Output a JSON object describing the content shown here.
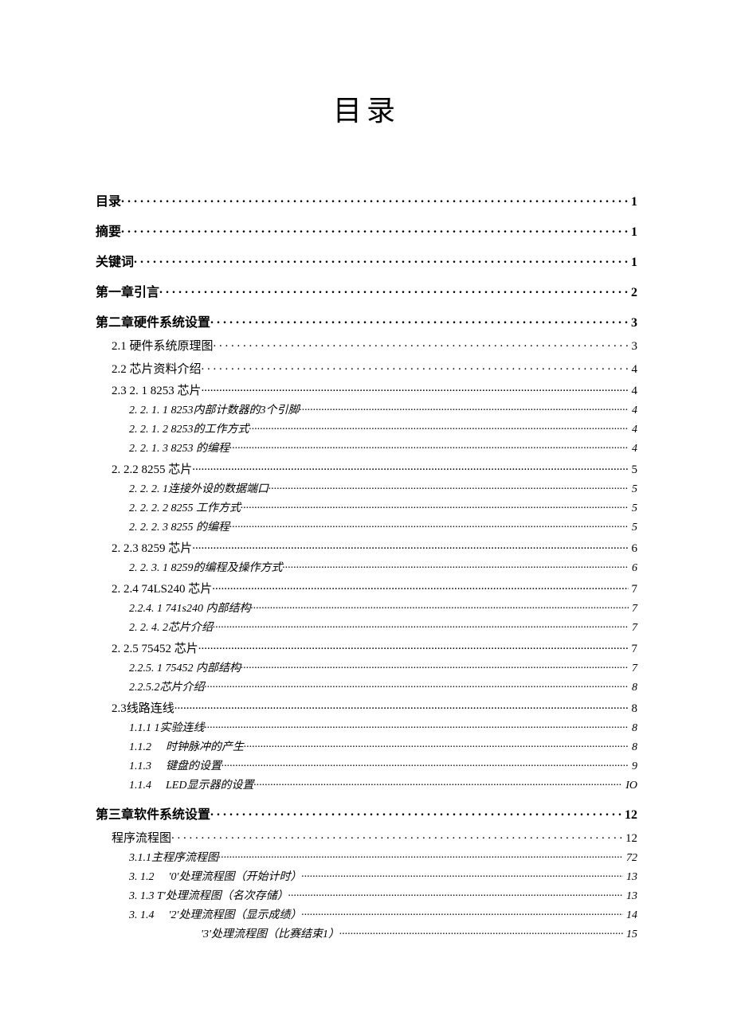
{
  "title": "目录",
  "toc": [
    {
      "level": 1,
      "label": "目录",
      "page": "1"
    },
    {
      "level": 1,
      "label": "摘要",
      "page": "1"
    },
    {
      "level": 1,
      "label": "关键词",
      "page": "1"
    },
    {
      "level": 1,
      "label": "第一章引言",
      "page": "2"
    },
    {
      "level": 1,
      "label": "第二章硬件系统设置",
      "page": "3"
    },
    {
      "level": 2,
      "label": "2.1  硬件系统原理图",
      "page": "3"
    },
    {
      "level": 2,
      "label": "2.2  芯片资料介绍",
      "page": "4"
    },
    {
      "level": 3,
      "label": "2.3 2. 1 8253 芯片",
      "page": "4"
    },
    {
      "level": 4,
      "label": "2. 2. 1. 1 8253内部计数器的3个引脚",
      "page": "4"
    },
    {
      "level": 4,
      "label": "2. 2. 1. 2 8253的工作方式",
      "page": "4"
    },
    {
      "level": 4,
      "label": "2. 2. 1. 3 8253 的编程",
      "page": "4"
    },
    {
      "level": 3,
      "label": "2. 2.2 8255 芯片",
      "page": "5"
    },
    {
      "level": 4,
      "label": "2. 2. 2. 1连接外设的数据端口",
      "page": "5"
    },
    {
      "level": 4,
      "label": "2. 2. 2. 2 8255 工作方式",
      "page": "5"
    },
    {
      "level": 4,
      "label": "2. 2. 2. 3 8255 的编程",
      "page": "5"
    },
    {
      "level": 3,
      "label": "2. 2.3 8259 芯片",
      "page": "6"
    },
    {
      "level": 4,
      "label": "2. 2. 3. 1 8259的编程及操作方式",
      "page": "6"
    },
    {
      "level": 3,
      "label": "2. 2.4 74LS240 芯片",
      "page": "7"
    },
    {
      "level": 4,
      "label": "2.2.4. 1 741s240 内部结构",
      "page": "7"
    },
    {
      "level": 4,
      "label": "2. 2. 4. 2芯片介绍",
      "page": "7"
    },
    {
      "level": 3,
      "label": "2. 2.5 75452 芯片",
      "page": "7"
    },
    {
      "level": 4,
      "label": "2.2.5. 1 75452 内部结构",
      "page": "7"
    },
    {
      "level": 4,
      "label": "2.2.5.2芯片介绍",
      "page": "8"
    },
    {
      "level": 3,
      "label": "2.3线路连线",
      "page": "8"
    },
    {
      "level": 4,
      "label": "1.1.1  1实验连线",
      "page": "8"
    },
    {
      "level": 4,
      "label_num": "1.1.2",
      "label": "时钟脉冲的产生",
      "page": "8"
    },
    {
      "level": 4,
      "label_num": "1.1.3",
      "label": "键盘的设置",
      "page": "9"
    },
    {
      "level": 4,
      "label_num": "1.1.4",
      "label": "LED显示器的设置",
      "page": "IO"
    },
    {
      "level": 1,
      "label": "第三章软件系统设置",
      "page": "12"
    },
    {
      "level": 2,
      "label": "程序流程图",
      "page": "12"
    },
    {
      "level": 4,
      "label": "3.1.1主程序流程图",
      "page": "72"
    },
    {
      "level": 4,
      "label_num": "3. 1.2",
      "label": "'0'处理流程图（开始计时）",
      "page": "13"
    },
    {
      "level": 4,
      "label": "3. 1.3 T'处理流程图（名次存储）",
      "page": "13"
    },
    {
      "level": 4,
      "label_num": "3. 1.4",
      "label": "'2'处理流程图（显示成绩）",
      "page": "14"
    },
    {
      "level": 4,
      "label_pad": true,
      "label": "'3'处理流程图（比赛结束1）",
      "page": "15"
    }
  ]
}
